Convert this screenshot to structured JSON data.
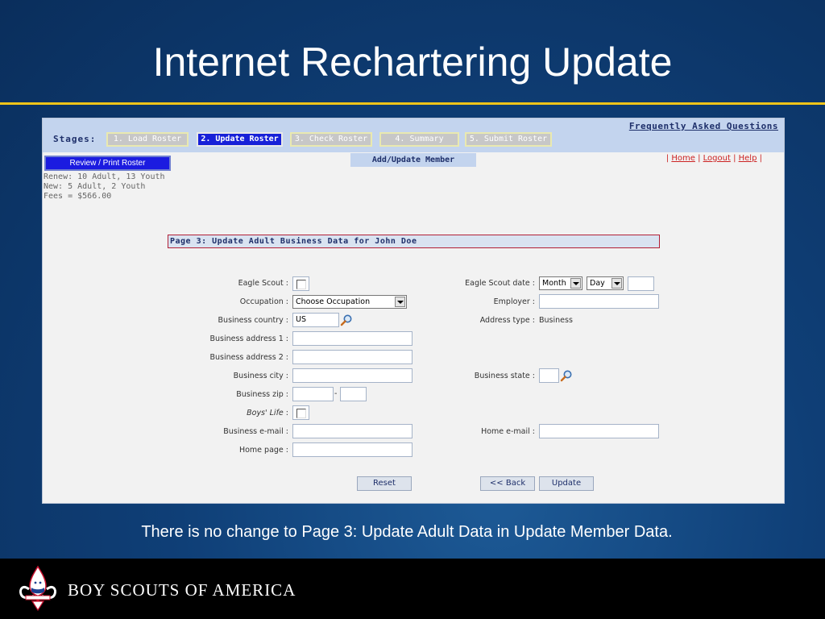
{
  "slide": {
    "title": "Internet Rechartering Update",
    "caption": "There is no change to Page 3: Update Adult Data in Update Member Data.",
    "footer_org": "BOY SCOUTS OF AMERICA"
  },
  "app": {
    "stages_label": "Stages:",
    "faq_link": "Frequently Asked Questions",
    "stages": [
      {
        "label": "1. Load Roster",
        "active": false
      },
      {
        "label": "2. Update Roster",
        "active": true
      },
      {
        "label": "3. Check Roster",
        "active": false
      },
      {
        "label": "4. Summary",
        "active": false
      },
      {
        "label": "5. Submit Roster",
        "active": false
      }
    ],
    "review_button": "Review / Print Roster",
    "summary_lines": [
      "Renew: 10 Adult, 13 Youth",
      "New: 5 Adult, 2 Youth",
      "Fees = $566.00"
    ],
    "page_tab": "Add/Update Member",
    "links": {
      "home": "Home",
      "logout": "Logout",
      "help": "Help"
    },
    "section_header": "Page 3: Update Adult Business Data for John Doe",
    "form": {
      "eagle_scout_label": "Eagle Scout :",
      "occupation_label": "Occupation :",
      "occupation_value": "Choose Occupation",
      "business_country_label": "Business country :",
      "business_country_value": "US",
      "business_address1_label": "Business address 1 :",
      "business_address2_label": "Business address 2 :",
      "business_city_label": "Business city :",
      "business_zip_label": "Business zip :",
      "zip_separator": "-",
      "boys_life_label": "Boys' Life",
      "boys_life_colon": ":",
      "business_email_label": "Business e-mail :",
      "home_page_label": "Home page :",
      "eagle_scout_date_label": "Eagle Scout date :",
      "month_value": "Month",
      "day_value": "Day",
      "employer_label": "Employer :",
      "address_type_label": "Address type :",
      "address_type_value": "Business",
      "business_state_label": "Business state :",
      "home_email_label": "Home e-mail :"
    },
    "buttons": {
      "reset": "Reset",
      "back": "<< Back",
      "update": "Update"
    }
  },
  "colors": {
    "title_rule": "#f0c419",
    "stage_active": "#1720d8",
    "header_border": "#b22036",
    "link_red": "#cc2222"
  }
}
